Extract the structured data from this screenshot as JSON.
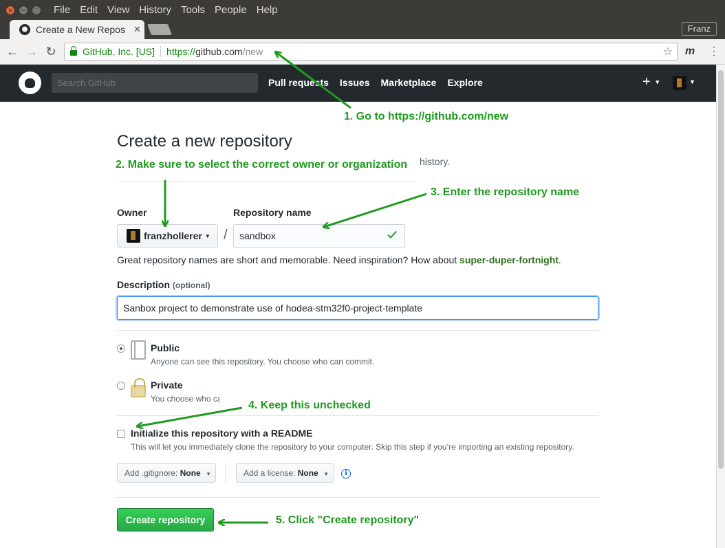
{
  "os_menu": {
    "items": [
      "File",
      "Edit",
      "View",
      "History",
      "Tools",
      "People",
      "Help"
    ]
  },
  "browser": {
    "tab_title": "Create a New Repos",
    "tab_close": "✕",
    "profile": "Franz",
    "security_label": "GitHub, Inc. [US]",
    "url_scheme": "https://",
    "url_host": "github.com",
    "url_path": "/new",
    "extension_label": "m"
  },
  "github_header": {
    "search_placeholder": "Search GitHub",
    "nav": [
      "Pull requests",
      "Issues",
      "Marketplace",
      "Explore"
    ],
    "plus": "+"
  },
  "form": {
    "title": "Create a new repository",
    "subhead_tail": "history.",
    "owner_label": "Owner",
    "owner_value": "franzhollerer",
    "slash": "/",
    "repo_label": "Repository name",
    "repo_value": "sandbox",
    "hint_text": "Great repository names are short and memorable. Need inspiration? How about ",
    "hint_suggestion": "super-duper-fortnight",
    "hint_end": ".",
    "description_label": "Description",
    "description_optional": "(optional)",
    "description_value": "Sanbox project to demonstrate use of hodea-stm32f0-project-template",
    "public_title": "Public",
    "public_note": "Anyone can see this repository. You choose who can commit.",
    "private_title": "Private",
    "private_note": "You choose who ca",
    "init_label": "Initialize this repository with a README",
    "init_note": "This will let you immediately clone the repository to your computer. Skip this step if you’re importing an existing repository.",
    "gitignore_prefix": "Add .gitignore:",
    "gitignore_value": "None",
    "license_prefix": "Add a license:",
    "license_value": "None",
    "info_glyph": "i",
    "create_button": "Create repository"
  },
  "annotations": {
    "step1": "1. Go to https://github.com/new",
    "step2": "2. Make sure to select the correct owner or organization",
    "step3": "3. Enter the repository name",
    "step4": "4. Keep this unchecked",
    "step5": "5. Click \"Create repository\""
  },
  "colors": {
    "annotation_green": "#1f9a1f",
    "github_header": "#24292e",
    "create_button": "#28a745"
  }
}
